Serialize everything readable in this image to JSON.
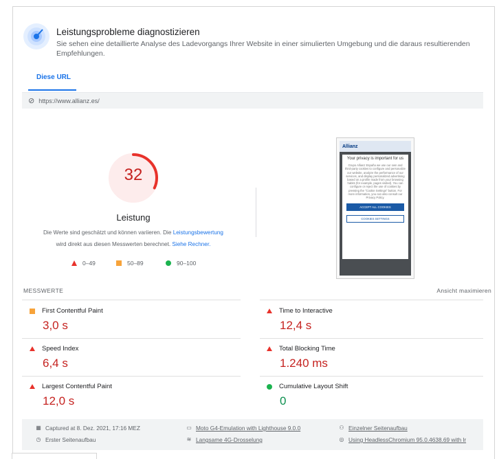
{
  "header": {
    "title": "Leistungsprobleme diagnostizieren",
    "description": "Sie sehen eine detaillierte Analyse des Ladevorgangs Ihrer Website in einer simulierten Umgebung und die daraus resultierenden Empfehlungen."
  },
  "tabs": [
    {
      "label": "Diese URL"
    }
  ],
  "url": "https://www.allianz.es/",
  "score": {
    "value": "32",
    "fraction": 0.32,
    "label": "Leistung",
    "note_part1": "Die Werte sind geschätzt und können variieren. Die ",
    "note_link1": "Leistungsbewertung",
    "note_part2": "wird direkt aus diesen Messwerten berechnet. ",
    "note_link2": "Siehe Rechner."
  },
  "legend": [
    {
      "range": "0–49"
    },
    {
      "range": "50–89"
    },
    {
      "range": "90–100"
    }
  ],
  "screenshot": {
    "brand": "Allianz",
    "heading": "Your privacy is important for us",
    "body": "Grupo Allianz España we use our own and third-party cookies to configure and personalize our website, analyze the performance of our services, and display personalized advertising based on a profile made from your browsing habits (for example, pages visited). You can configure or reject the use of cookies by pressing the \"Cookie Settings\" button. For more information, you can also consult our Privacy Policy.",
    "accept": "ACCEPT ALL COOKIES",
    "settings": "COOKIES SETTINGS"
  },
  "metrics_section": {
    "label": "MESSWERTE",
    "expand": "Ansicht maximieren"
  },
  "metrics": [
    {
      "name": "First Contentful Paint",
      "value": "3,0 s",
      "status": "average"
    },
    {
      "name": "Time to Interactive",
      "value": "12,4 s",
      "status": "fail"
    },
    {
      "name": "Speed Index",
      "value": "6,4 s",
      "status": "fail"
    },
    {
      "name": "Total Blocking Time",
      "value": "1.240 ms",
      "status": "fail"
    },
    {
      "name": "Largest Contentful Paint",
      "value": "12,0 s",
      "status": "fail"
    },
    {
      "name": "Cumulative Layout Shift",
      "value": "0",
      "status": "pass"
    }
  ],
  "footer": {
    "captured": "Captured at 8. Dez. 2021, 17:16 MEZ",
    "device": "Moto G4-Emulation with Lighthouse 9.0.0",
    "session": "Einzelner Seitenaufbau",
    "initial": "Erster Seitenaufbau",
    "throttling": "Langsame 4G-Drosselung",
    "browser": "Using HeadlessChromium 95.0.4638.69 with lr"
  },
  "colors": {
    "fail": "#c5221f",
    "average": "#f7a33a",
    "pass": "#0d904f",
    "accent": "#1a73e8"
  }
}
